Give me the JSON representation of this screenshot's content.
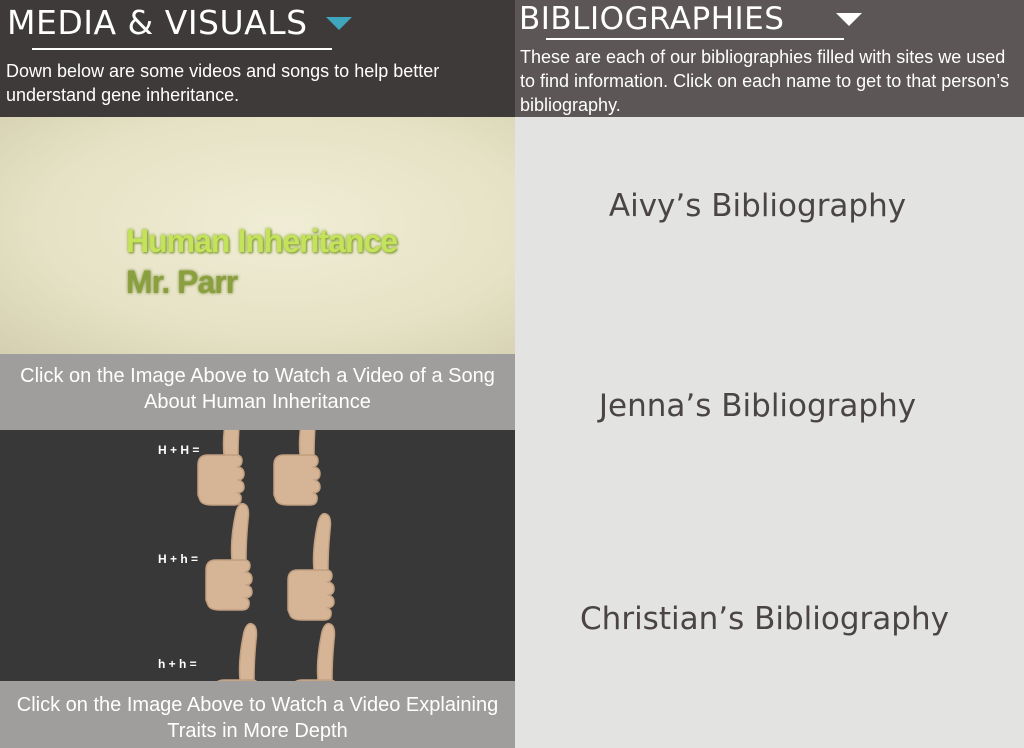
{
  "media": {
    "title": "MEDIA & VISUALS",
    "description": "Down below are some videos and songs to help better understand gene inheritance.",
    "video1": {
      "title_line1": "Human Inheritance",
      "title_line2": "Mr. Parr",
      "caption": "Click on the Image Above to Watch a Video of a Song About Human Inheritance"
    },
    "video2": {
      "labels": [
        "H + H =",
        "H + h =",
        "h + h ="
      ],
      "caption": "Click on the Image Above to Watch a Video Explaining Traits in More Depth"
    }
  },
  "bibliographies": {
    "title": "BIBLIOGRAPHIES",
    "description": "These are each of our bibliographies filled with sites we used to find information. Click on each name to get to that person’s bibliography.",
    "links": [
      "Aivy’s Bibliography",
      "Jenna’s Bibliography",
      "Christian’s Bibliography"
    ]
  },
  "colors": {
    "media_header_bg": "#3f3a3a",
    "bib_header_bg": "#5c5656",
    "caption_bg": "#a09e9d",
    "media_caret": "#3ea7bd",
    "bib_area_bg": "#e3e3e1"
  },
  "icons": [
    "chevron-down-icon",
    "thumbs-up-icon"
  ]
}
